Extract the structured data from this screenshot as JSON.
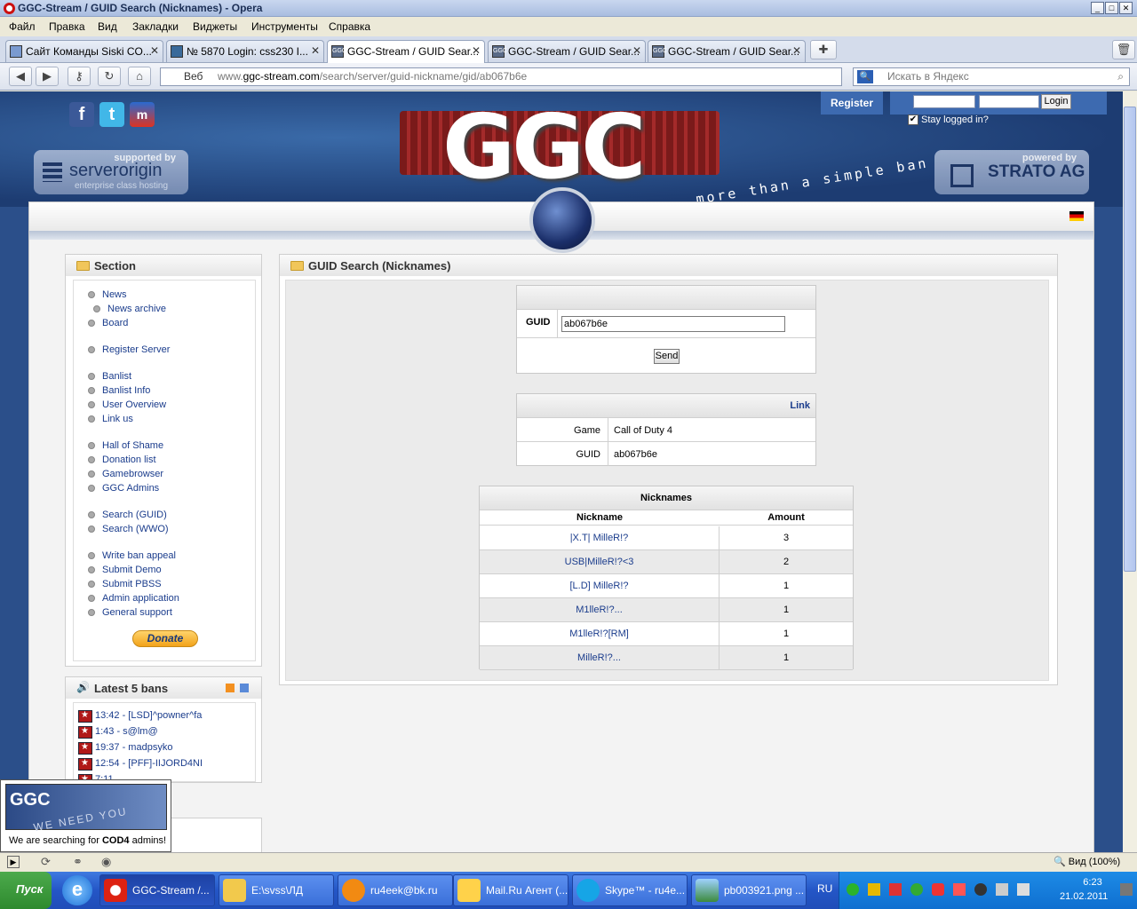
{
  "window": {
    "title": "GGC-Stream / GUID Search (Nicknames) - Opera"
  },
  "menu": [
    "Файл",
    "Правка",
    "Вид",
    "Закладки",
    "Виджеты",
    "Инструменты",
    "Справка"
  ],
  "tabs": [
    {
      "label": "Сайт Команды Siski CO..."
    },
    {
      "label": "№ 5870 Login: css230 I..."
    },
    {
      "label": "GGC-Stream / GUID Sear..."
    },
    {
      "label": "GGC-Stream / GUID Sear..."
    },
    {
      "label": "GGC-Stream / GUID Sear..."
    }
  ],
  "address": {
    "prefix_label": "Веб",
    "host_prefix": "www.",
    "host": "ggc-stream.com",
    "path": "/search/server/guid-nickname/gid/ab067b6e"
  },
  "search": {
    "placeholder": "Искать в Яндекс"
  },
  "header": {
    "register": "Register",
    "login": "Login",
    "stay_logged": "Stay logged in?",
    "sponsor_left": {
      "label": "supported by",
      "name": "serverorigin",
      "sub": "enterprise class hosting"
    },
    "sponsor_right": {
      "label": "powered by",
      "name": "STRATO AG"
    },
    "logo_text": "GGC",
    "tagline": "more than a simple ban"
  },
  "sidebar": {
    "title": "Section",
    "groups": [
      [
        "News",
        "News archive",
        "Board"
      ],
      [
        "Register Server"
      ],
      [
        "Banlist",
        "Banlist Info",
        "User Overview",
        "Link us"
      ],
      [
        "Hall of Shame",
        "Donation list",
        "Gamebrowser",
        "GGC Admins"
      ],
      [
        "Search (GUID)",
        "Search (WWO)"
      ],
      [
        "Write ban appeal",
        "Submit Demo",
        "Submit PBSS",
        "Admin application",
        "General support"
      ]
    ],
    "donate": "Donate"
  },
  "bans": {
    "title": "Latest 5 bans",
    "items": [
      "13:42 - [LSD]^powner^fa",
      "1:43 - s@lm@",
      "19:37 - madpsyko",
      "12:54 - [PFF]-IIJORD4NI",
      "7:11"
    ]
  },
  "ad": {
    "caption_pre": "We are searching for ",
    "caption_bold": "COD4",
    "caption_post": " admins!",
    "logo": "GGC",
    "banner_text": "WE NEED YOU"
  },
  "main": {
    "title": "GUID Search (Nicknames)",
    "form": {
      "label": "GUID",
      "value": "ab067b6e",
      "send": "Send"
    },
    "info": {
      "link": "Link",
      "rows": [
        {
          "k": "Game",
          "v": "Call of Duty 4"
        },
        {
          "k": "GUID",
          "v": "ab067b6e"
        }
      ]
    },
    "nicknames": {
      "title": "Nicknames",
      "col_nick": "Nickname",
      "col_amount": "Amount",
      "rows": [
        {
          "nick": "|X.T| MilleR!?",
          "amount": "3"
        },
        {
          "nick": "USB|MilleR!?<3",
          "amount": "2"
        },
        {
          "nick": "[L.D] MilleR!?",
          "amount": "1"
        },
        {
          "nick": "M1lleR!?...",
          "amount": "1"
        },
        {
          "nick": "M1lleR!?[RM]",
          "amount": "1"
        },
        {
          "nick": "MilleR!?...",
          "amount": "1"
        }
      ]
    }
  },
  "statusbar": {
    "zoom": "Вид (100%)"
  },
  "taskbar": {
    "start": "Пуск",
    "tasks": [
      "GGC-Stream /...",
      "E:\\svss\\ЛД",
      "ru4eek@bk.ru",
      "Mail.Ru Агент (...",
      "Skype™ - ru4e...",
      "pb003921.png ..."
    ],
    "lang": "RU",
    "time": "6:23",
    "date": "21.02.2011"
  }
}
